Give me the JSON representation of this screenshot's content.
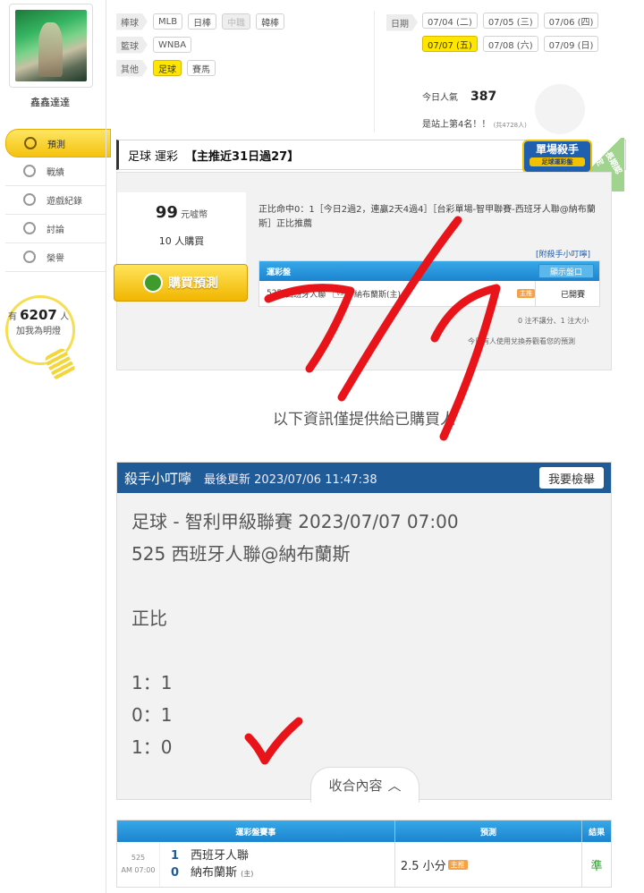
{
  "user": {
    "name": "鑫鑫達達"
  },
  "side_nav": [
    {
      "label": "預測",
      "icon": "target-icon",
      "active": true
    },
    {
      "label": "戰績",
      "icon": "medal-icon",
      "active": false
    },
    {
      "label": "遊戲紀錄",
      "icon": "record-icon",
      "active": false
    },
    {
      "label": "討論",
      "icon": "chat-icon",
      "active": false
    },
    {
      "label": "榮譽",
      "icon": "trophy-icon",
      "active": false
    }
  ],
  "fans": {
    "prefix": "有",
    "count": "6207",
    "suffix": "人",
    "line2": "加我為明燈"
  },
  "categories": {
    "baseball": {
      "head": "棒球",
      "items": [
        "MLB",
        "日棒",
        "中職",
        "韓棒"
      ]
    },
    "basketball": {
      "head": "籃球",
      "items": [
        "WNBA"
      ]
    },
    "other": {
      "head": "其他",
      "items": [
        "足球",
        "賽馬"
      ]
    }
  },
  "dates": {
    "head": "日期",
    "row1": [
      "07/04 (二)",
      "07/05 (三)",
      "07/06 (四)"
    ],
    "row2": [
      "07/07 (五)",
      "07/08 (六)",
      "07/09 (日)"
    ]
  },
  "popularity": {
    "label": "今日人氣",
    "value": "387",
    "rank": "是站上第4名！！",
    "total": "(共4728人)"
  },
  "title": {
    "sport": "足球",
    "type": "運彩",
    "stat": "【主推近31日過27】"
  },
  "badge": {
    "main": "單場殺手",
    "sub": "足球運彩盤",
    "tag": "長期認定"
  },
  "prediction": {
    "price_value": "99",
    "price_unit": "元嘘幣",
    "buyers": "10 人購買",
    "buy_button": "購買預測",
    "desc": "正比命中0：1［今日2過2，連贏2天4過4］［台彩單場-智甲聯賽-西班牙人聯@納布蘭斯］正比推薦",
    "attach_link": "[附殺手小叮嚀]",
    "table_head": "運彩盤",
    "show_button": "顯示盤口",
    "game_num": "525",
    "home_team": "西班牙人聯",
    "vs": "vs",
    "away_team": "納布蘭斯(主)",
    "host_tag": "主推",
    "status": "已開賽",
    "rule_note": "0 注不讓分、1 注大小",
    "usage_note": "今日有人使用兌換券觀看您的預測"
  },
  "buyers_only": "以下資訊僅提供給已購買人",
  "tip": {
    "title": "殺手小叮嚀",
    "updated": "最後更新 2023/07/06 11:47:38",
    "report_button": "我要檢舉",
    "line1": "足球 - 智利甲級聯賽 2023/07/07 07:00",
    "line2": "525 西班牙人聯@納布蘭斯",
    "line3": "正比",
    "score1": "1：1",
    "score2": "0：1",
    "score3": "1：0",
    "collapse": "收合內容"
  },
  "results": {
    "headers": [
      "運彩盤賽事",
      "預測",
      "結果"
    ],
    "row": {
      "game_num": "525",
      "time": "AM 07:00",
      "team1_score": "1",
      "team1": "西班牙人聯",
      "team2_score": "0",
      "team2": "納布蘭斯",
      "host_mark": "(主)",
      "prediction": "2.5 小分",
      "pred_tag": "主推",
      "result": "準"
    }
  },
  "colors": {
    "accent_yellow": "#ffe600",
    "header_blue": "#1f5b96",
    "table_blue": "#1c84cf",
    "annotation_red": "#e8141a"
  }
}
